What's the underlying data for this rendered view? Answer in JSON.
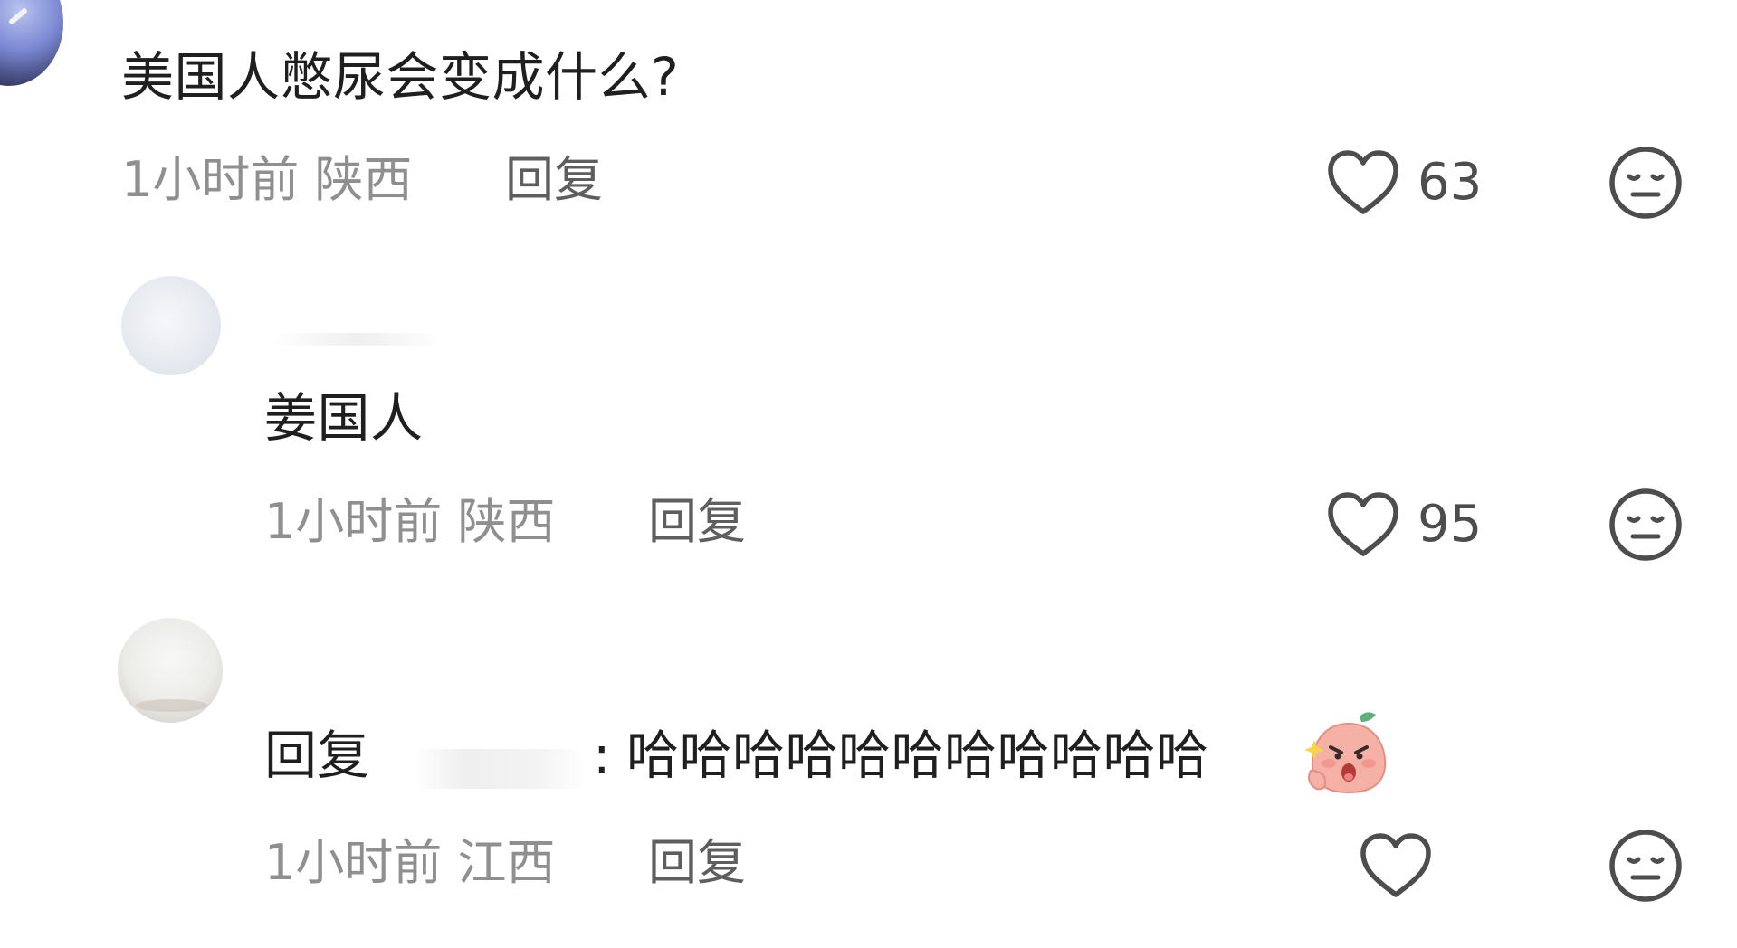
{
  "comments": [
    {
      "text": "美国人憋尿会变成什么?",
      "time": "1小时前",
      "location": "陕西",
      "reply_label": "回复",
      "likes": "63"
    },
    {
      "text": "姜国人",
      "time": "1小时前",
      "location": "陕西",
      "reply_label": "回复",
      "likes": "95"
    },
    {
      "reply_prefix": "回复",
      "text": "哈哈哈哈哈哈哈哈哈哈哈",
      "time": "1小时前",
      "location": "江西",
      "reply_label": "回复",
      "likes": ""
    }
  ],
  "icons": {
    "like": "heart-outline-icon",
    "dislike": "meh-face-icon",
    "sticker": "laughing-peach-sticker"
  },
  "colors": {
    "text": "#1f1f1f",
    "meta": "#8f8f8f",
    "reply": "#5e5e5e",
    "icon": "#4d4d4d"
  }
}
